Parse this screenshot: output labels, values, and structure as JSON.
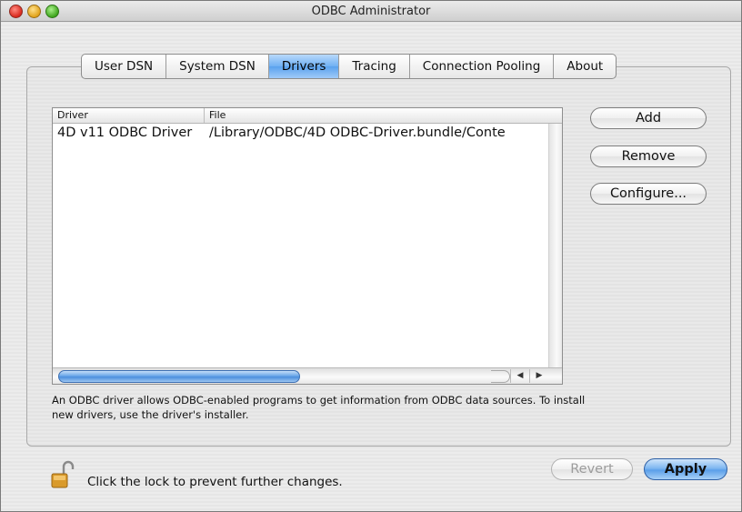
{
  "window": {
    "title": "ODBC Administrator"
  },
  "tabs": [
    {
      "label": "User DSN",
      "active": false
    },
    {
      "label": "System DSN",
      "active": false
    },
    {
      "label": "Drivers",
      "active": true
    },
    {
      "label": "Tracing",
      "active": false
    },
    {
      "label": "Connection Pooling",
      "active": false
    },
    {
      "label": "About",
      "active": false
    }
  ],
  "driver_list": {
    "columns": [
      "Driver",
      "File"
    ],
    "rows": [
      {
        "driver": "4D v11 ODBC Driver",
        "file": "/Library/ODBC/4D ODBC-Driver.bundle/Conte"
      }
    ]
  },
  "buttons": {
    "add": "Add",
    "remove": "Remove",
    "configure": "Configure...",
    "revert": "Revert",
    "apply": "Apply"
  },
  "description": "An ODBC driver allows ODBC-enabled programs to get information from ODBC data sources. To install new drivers, use the driver's installer.",
  "lock": {
    "text": "Click the lock to prevent further changes."
  },
  "icons": {
    "close": "close-icon",
    "minimize": "minimize-icon",
    "zoom": "zoom-icon",
    "lock": "lock-open-icon",
    "scroll_left": "arrow-left-icon",
    "scroll_right": "arrow-right-icon"
  },
  "colors": {
    "accent": "#5aa2ee",
    "disabled_text": "#9c9c9c"
  }
}
